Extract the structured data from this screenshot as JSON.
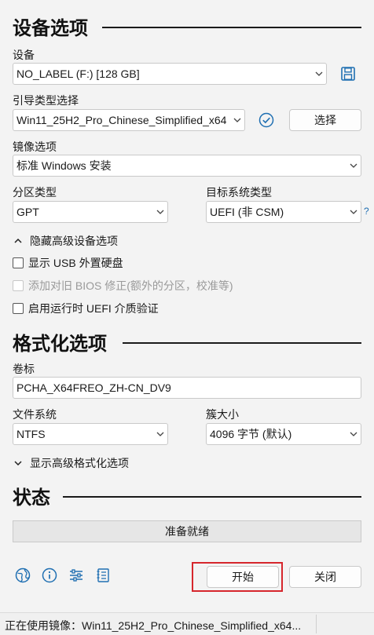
{
  "device_section": {
    "title": "设备选项"
  },
  "device": {
    "label": "设备",
    "value": "NO_LABEL (F:) [128 GB]"
  },
  "boot": {
    "label": "引导类型选择",
    "value": "Win11_25H2_Pro_Chinese_Simplified_x64",
    "select_button": "选择"
  },
  "image_option": {
    "label": "镜像选项",
    "value": "标准 Windows 安装"
  },
  "partition": {
    "label": "分区类型",
    "value": "GPT"
  },
  "target": {
    "label": "目标系统类型",
    "value": "UEFI (非 CSM)",
    "help": "?"
  },
  "advanced_device": {
    "toggle": "隐藏高级设备选项",
    "options": [
      {
        "label": "显示 USB 外置硬盘",
        "checked": false,
        "enabled": true
      },
      {
        "label": "添加对旧 BIOS 修正(额外的分区，校准等)",
        "checked": false,
        "enabled": false
      },
      {
        "label": "启用运行时 UEFI 介质验证",
        "checked": false,
        "enabled": true
      }
    ]
  },
  "format_section": {
    "title": "格式化选项"
  },
  "volume": {
    "label": "卷标",
    "value": "PCHA_X64FREO_ZH-CN_DV9"
  },
  "filesystem": {
    "label": "文件系统",
    "value": "NTFS"
  },
  "cluster": {
    "label": "簇大小",
    "value": "4096 字节 (默认)"
  },
  "advanced_format": {
    "toggle": "显示高级格式化选项"
  },
  "status_section": {
    "title": "状态"
  },
  "status": {
    "text": "准备就绪",
    "progress": 0
  },
  "actions": {
    "start": "开始",
    "close": "关闭"
  },
  "icons": [
    "globe-icon",
    "info-icon",
    "settings-sliders-icon",
    "log-icon"
  ],
  "colors": {
    "accent": "#1f6fb2",
    "highlight": "#d6262c"
  },
  "footer": {
    "text": "正在使用镜像：Win11_25H2_Pro_Chinese_Simplified_x64..."
  }
}
